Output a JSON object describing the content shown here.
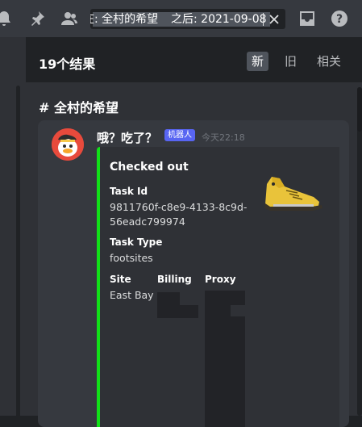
{
  "search": {
    "chip_prefix": "在: 全村的希望",
    "chip_after": "之后: 2021-09-08"
  },
  "results": {
    "count_label": "19个结果",
    "sort_tabs": [
      {
        "label": "新",
        "active": true
      },
      {
        "label": "旧",
        "active": false
      },
      {
        "label": "相关",
        "active": false
      }
    ],
    "channel_name": "# 全村的希望"
  },
  "message": {
    "author": "哦？吃了？",
    "bot_badge": "机器人",
    "timestamp": "今天22:18",
    "embed": {
      "accent_color": "#11e018",
      "title": "Checked out",
      "fields": {
        "task_id": {
          "name": "Task Id",
          "value": "9811760f-c8e9-4133-8c9d-56eadc799974"
        },
        "task_type": {
          "name": "Task Type",
          "value": "footsites"
        },
        "site": {
          "name": "Site",
          "value": "East Bay"
        },
        "billing": {
          "name": "Billing"
        },
        "proxy": {
          "name": "Proxy"
        }
      }
    }
  },
  "icons": [
    "bell-icon",
    "pin-icon",
    "members-icon",
    "close-icon",
    "inbox-icon",
    "help-icon"
  ]
}
